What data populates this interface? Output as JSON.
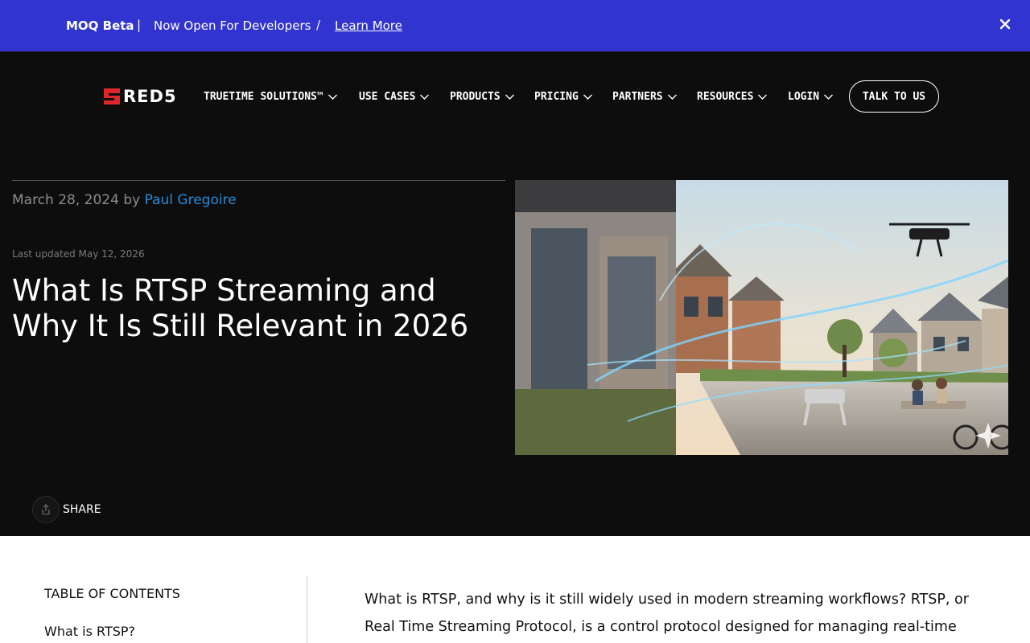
{
  "announcement": {
    "strong": "MOQ Beta",
    "separator1": "|",
    "message": "Now Open For Developers",
    "separator2": "/",
    "link": "Learn More",
    "close_icon": "close-icon"
  },
  "nav": {
    "logo_text": "RED5",
    "items": [
      {
        "label": "TRUETIME SOLUTIONS™"
      },
      {
        "label": "USE CASES"
      },
      {
        "label": "PRODUCTS"
      },
      {
        "label": "PRICING"
      },
      {
        "label": "PARTNERS"
      },
      {
        "label": "RESOURCES"
      },
      {
        "label": "LOGIN"
      }
    ],
    "cta": "TALK TO US"
  },
  "article": {
    "date": "March 28, 2024",
    "by": "by",
    "author": "Paul Gregoire",
    "last_updated": "Last updated May 12, 2026",
    "title": "What Is RTSP Streaming and Why It Is Still Relevant in 2026",
    "share": "SHARE"
  },
  "toc": {
    "heading": "TABLE OF CONTENTS",
    "items": [
      "What is RTSP?"
    ]
  },
  "body": {
    "intro": "What is RTSP, and why is it still widely used in modern streaming workflows? RTSP, or Real Time Streaming Protocol, is a control protocol designed for managing real-time audio and"
  },
  "colors": {
    "announcement_bg": "#3234cf",
    "page_bg": "#0d0d0d",
    "brand_red": "#e0252b",
    "author_link": "#2a8ad6"
  }
}
